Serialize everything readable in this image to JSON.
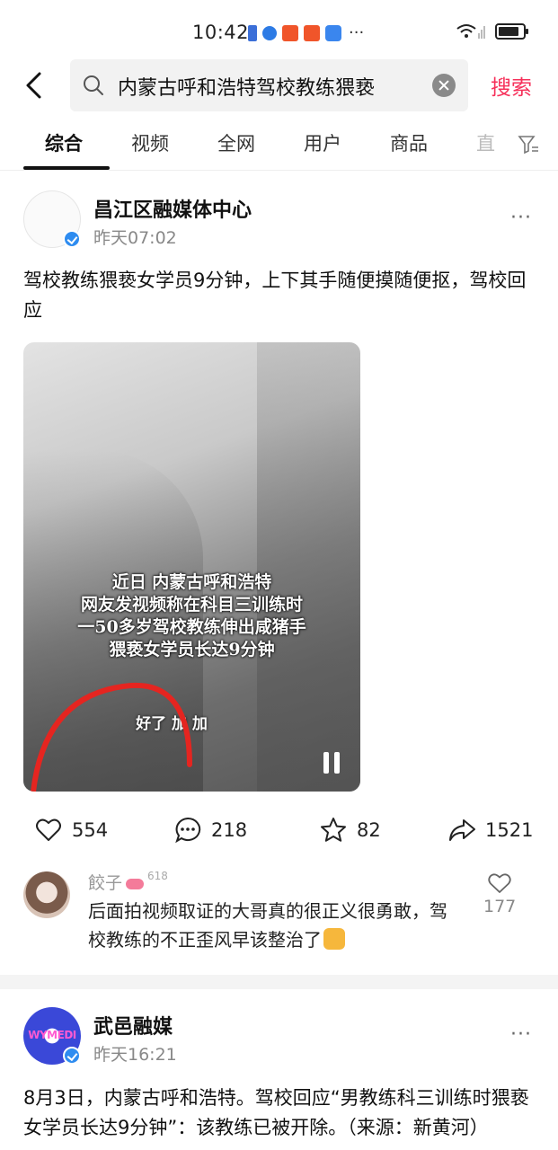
{
  "status_bar": {
    "time": "10:42",
    "more": "···"
  },
  "search": {
    "query": "内蒙古呼和浩特驾校教练猥亵",
    "button_label": "搜索"
  },
  "tabs": [
    {
      "label": "综合"
    },
    {
      "label": "视频"
    },
    {
      "label": "全网"
    },
    {
      "label": "用户"
    },
    {
      "label": "商品"
    },
    {
      "label": "直"
    }
  ],
  "posts": [
    {
      "author": "昌江区融媒体中心",
      "time": "昨天07:02",
      "more": "···",
      "text": "驾校教练猥亵女学员9分钟，上下其手随便摸随便抠，驾校回应",
      "video": {
        "caption_lines": [
          "近日 内蒙古呼和浩特",
          "网友发视频称在科目三训练时",
          "一50多岁驾校教练伸出咸猪手",
          "猥亵女学员长达9分钟"
        ],
        "subtitle": "好了 加 加"
      },
      "actions": {
        "likes": "554",
        "comments": "218",
        "favorites": "82",
        "shares": "1521"
      },
      "top_comment": {
        "user": "餃子",
        "badge": "618",
        "text": "后面拍视频取证的大哥真的很正义很勇敢，驾校教练的不正歪风早该整治了",
        "likes": "177"
      }
    },
    {
      "author": "武邑融媒",
      "time": "昨天16:21",
      "more": "···",
      "avatar_text": "WYMEDI",
      "text": "8月3日，内蒙古呼和浩特。驾校回应“男教练科三训练时猥亵女学员长达9分钟”：该教练已被开除。（来源：新黄河）"
    }
  ]
}
